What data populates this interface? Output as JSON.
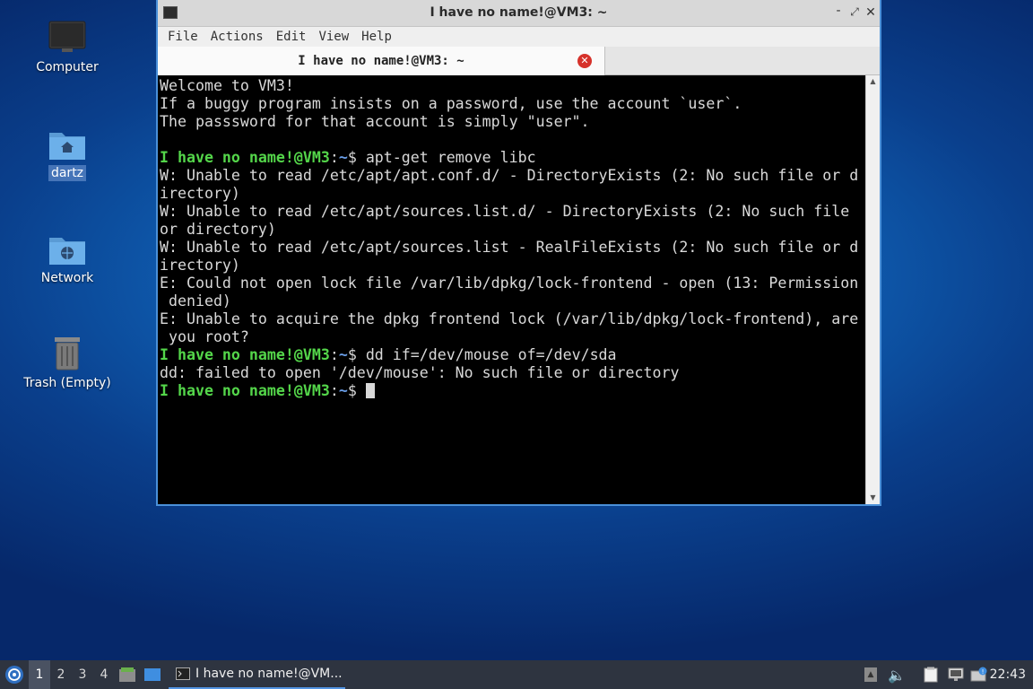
{
  "desktop": {
    "icons": [
      {
        "label": "Computer",
        "icon": "computer-icon"
      },
      {
        "label": "dartz",
        "icon": "home-folder-icon"
      },
      {
        "label": "Network",
        "icon": "network-folder-icon"
      },
      {
        "label": "Trash (Empty)",
        "icon": "trash-icon"
      }
    ]
  },
  "window": {
    "title": "I have no name!@VM3: ~",
    "menu": [
      "File",
      "Actions",
      "Edit",
      "View",
      "Help"
    ],
    "tab_label": "I have no name!@VM3: ~"
  },
  "terminal": {
    "lines": [
      "Welcome to VM3!",
      "If a buggy program insists on a password, use the account `user`.",
      "The passsword for that account is simply \"user\".",
      "",
      "W: Unable to read /etc/apt/apt.conf.d/ - DirectoryExists (2: No such file or d",
      "irectory)",
      "W: Unable to read /etc/apt/sources.list.d/ - DirectoryExists (2: No such file",
      "or directory)",
      "W: Unable to read /etc/apt/sources.list - RealFileExists (2: No such file or d",
      "irectory)",
      "E: Could not open lock file /var/lib/dpkg/lock-frontend - open (13: Permission",
      " denied)",
      "E: Unable to acquire the dpkg frontend lock (/var/lib/dpkg/lock-frontend), are",
      " you root?",
      "dd: failed to open '/dev/mouse': No such file or directory"
    ],
    "prompt_user": "I have no name!@VM3",
    "prompt_sep": ":",
    "prompt_path": "~",
    "prompt_dollar": "$ ",
    "cmd1": "apt-get remove libc",
    "cmd2": "dd if=/dev/mouse of=/dev/sda"
  },
  "taskbar": {
    "workspaces": [
      "1",
      "2",
      "3",
      "4"
    ],
    "active_workspace": "1",
    "task_label": "I have no name!@VM...",
    "clock": "22:43"
  }
}
